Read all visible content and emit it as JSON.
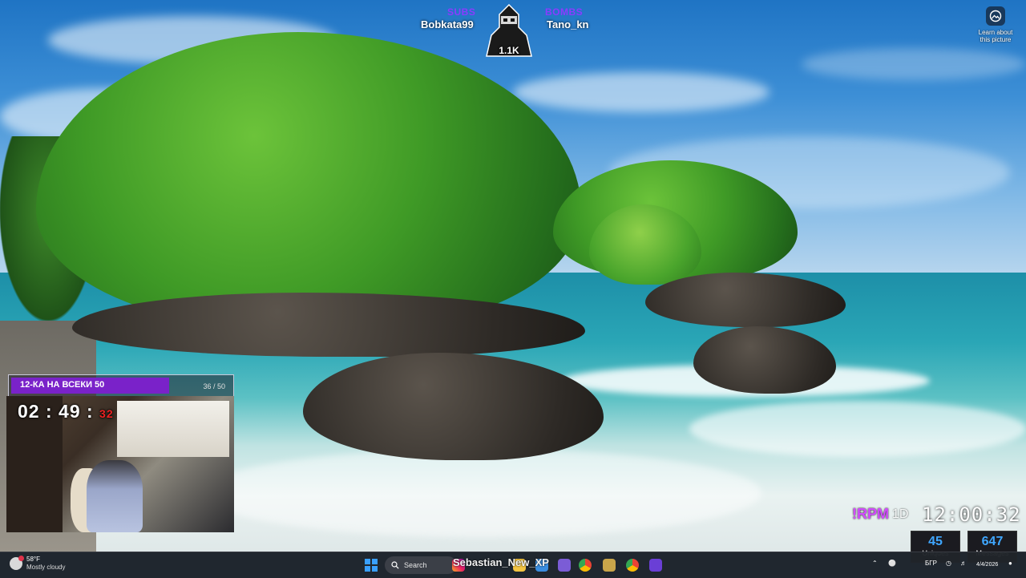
{
  "overlay": {
    "subs_label": "SUBS",
    "subs_name": "Bobkata99",
    "bombs_label": "BOMBS",
    "bombs_name": "Tano_kn",
    "mascot_count": "1.1K"
  },
  "wallpaper": {
    "learn_text_line1": "Learn about",
    "learn_text_line2": "this picture"
  },
  "goal": {
    "title": "12-КА НА ВСЕКИ 50",
    "count": "36 / 50",
    "progress": 0.72,
    "color": "#7a22c9"
  },
  "timer": {
    "main": "02 : 49 :",
    "seconds": "32"
  },
  "rpm": {
    "label": "!RPM",
    "suffix": "1D",
    "clock": "12:00:32"
  },
  "stats": {
    "uniques_value": "45",
    "uniques_label": "Uniques",
    "messages_value": "647",
    "messages_label": "Messages"
  },
  "taskbar": {
    "weather_temp": "58°F",
    "weather_desc": "Mostly cloudy",
    "search_placeholder": "Search",
    "overlay_user": "Sebastian_New_XP",
    "language": "БГР",
    "date": "4/4/2026"
  },
  "colors": {
    "accent_purple": "#8a3bff",
    "rpm_pink": "#d24bff",
    "stat_blue": "#3fa7ff",
    "windows_blue": "#3aa0ff"
  },
  "icons": [
    "windows-start-icon",
    "search-icon",
    "instagram-icon",
    "file-explorer-icon",
    "chrome-icon",
    "app-icon",
    "tray-chevron-icon",
    "wifi-icon",
    "volume-icon",
    "notification-icon",
    "help-icon"
  ]
}
